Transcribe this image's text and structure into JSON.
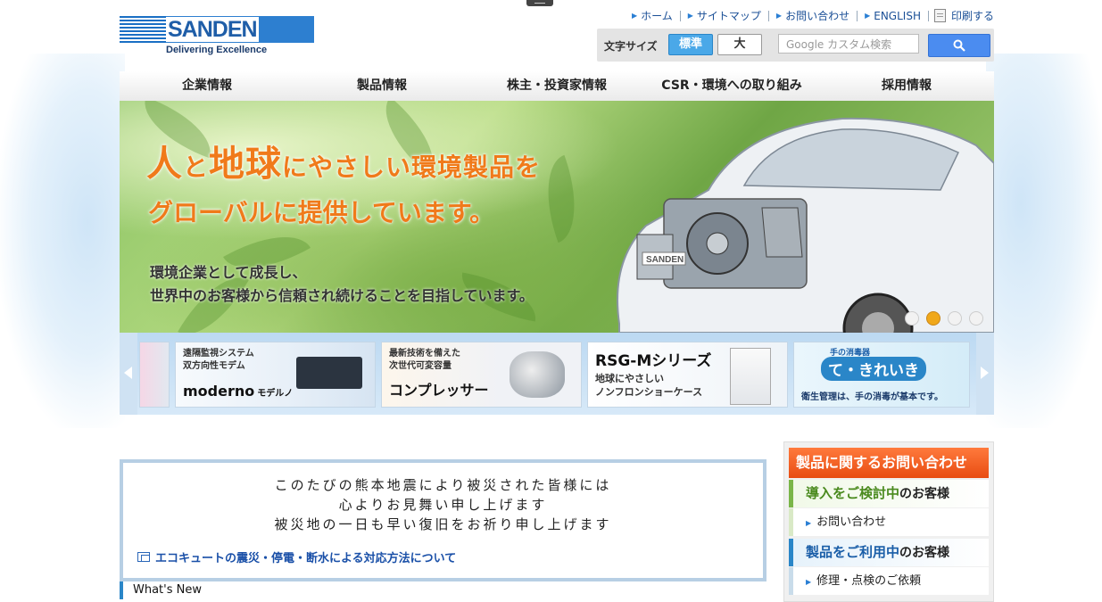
{
  "header": {
    "brand": "SANDEN",
    "tagline": "Delivering Excellence",
    "util_links": [
      "ホーム",
      "サイトマップ",
      "お問い合わせ",
      "ENGLISH"
    ],
    "print_label": "印刷する",
    "font_size_label": "文字サイズ",
    "font_size_standard": "標準",
    "font_size_large": "大",
    "search_placeholder": "Google カスタム検索"
  },
  "nav": [
    "企業情報",
    "製品情報",
    "株主・投資家情報",
    "CSR・環境への取り組み",
    "採用情報"
  ],
  "hero": {
    "line1_a": "人",
    "line1_b": "と",
    "line1_c": "地球",
    "line1_d": "にやさしい環境製品を",
    "line2": "グローバルに提供しています。",
    "sub1": "環境企業として成長し、",
    "sub2": "世界中のお客様から信頼され続けることを目指しています。",
    "car_badge": "SANDEN"
  },
  "banners": [
    {
      "top": "遠隔監視システム\n双方向性モデム",
      "title": "moderno",
      "suffix": "モデルノ"
    },
    {
      "top": "最新技術を備えた\n次世代可変容量",
      "title": "コンプレッサー"
    },
    {
      "title": "RSG-Mシリーズ",
      "sub": "地球にやさしい\nノンフロンショーケース"
    },
    {
      "top": "手の消毒器",
      "title": "て・きれいき",
      "sub": "衛生管理は、手の消毒が基本です。"
    }
  ],
  "notice": {
    "lines": [
      "このたびの熊本地震により被災された皆様には",
      "心よりお見舞い申し上げます",
      "被災地の一日も早い復旧をお祈り申し上げます"
    ],
    "link": "エコキュートの震災・停電・断水による対応方法について"
  },
  "whats_new": "What's New",
  "sidebar": {
    "title": "製品に関するお問い合わせ",
    "sec1_hl": "導入をご検討中",
    "sec1_rest": "のお客様",
    "sec1_link": "お問い合わせ",
    "sec2_hl": "製品をご利用中",
    "sec2_rest": "のお客様",
    "sec2_link": "修理・点検のご依頼"
  },
  "colors": {
    "accent": "#2d7fd0",
    "hero_orange": "#f07a1a",
    "sidebar_head": "#e84c12"
  }
}
